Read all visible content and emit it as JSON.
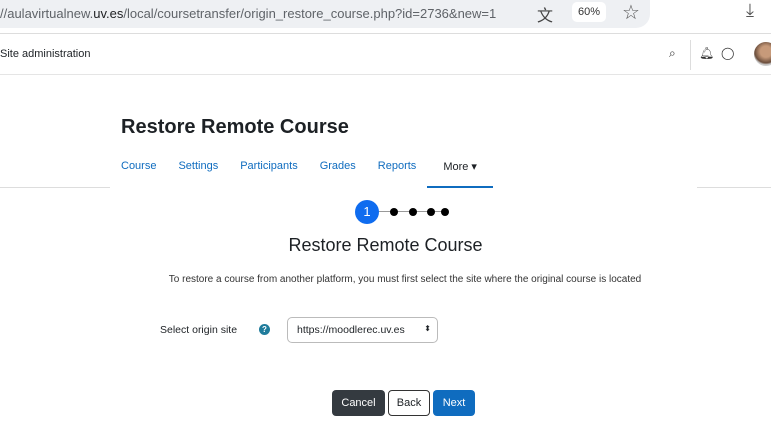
{
  "browser": {
    "url_prefix": "//aulavirtualnew.",
    "url_domain": "uv.es",
    "url_path": "/local/coursetransfer/origin_restore_course.php?id=2736&new=1",
    "zoom": "60%"
  },
  "navbar": {
    "site_admin": "Site administration"
  },
  "page": {
    "title": "Restore Remote Course"
  },
  "tabs": [
    {
      "label": "Course"
    },
    {
      "label": "Settings"
    },
    {
      "label": "Participants"
    },
    {
      "label": "Grades"
    },
    {
      "label": "Reports"
    },
    {
      "label": "More ▾"
    }
  ],
  "stepper": {
    "current": "1",
    "total_steps": 5
  },
  "form": {
    "heading": "Restore Remote Course",
    "description": "To restore a course from another platform, you must first select the site where the original course is located",
    "site_label": "Select origin site",
    "site_value": "https://moodlerec.uv.es"
  },
  "buttons": {
    "cancel": "Cancel",
    "back": "Back",
    "next": "Next"
  }
}
